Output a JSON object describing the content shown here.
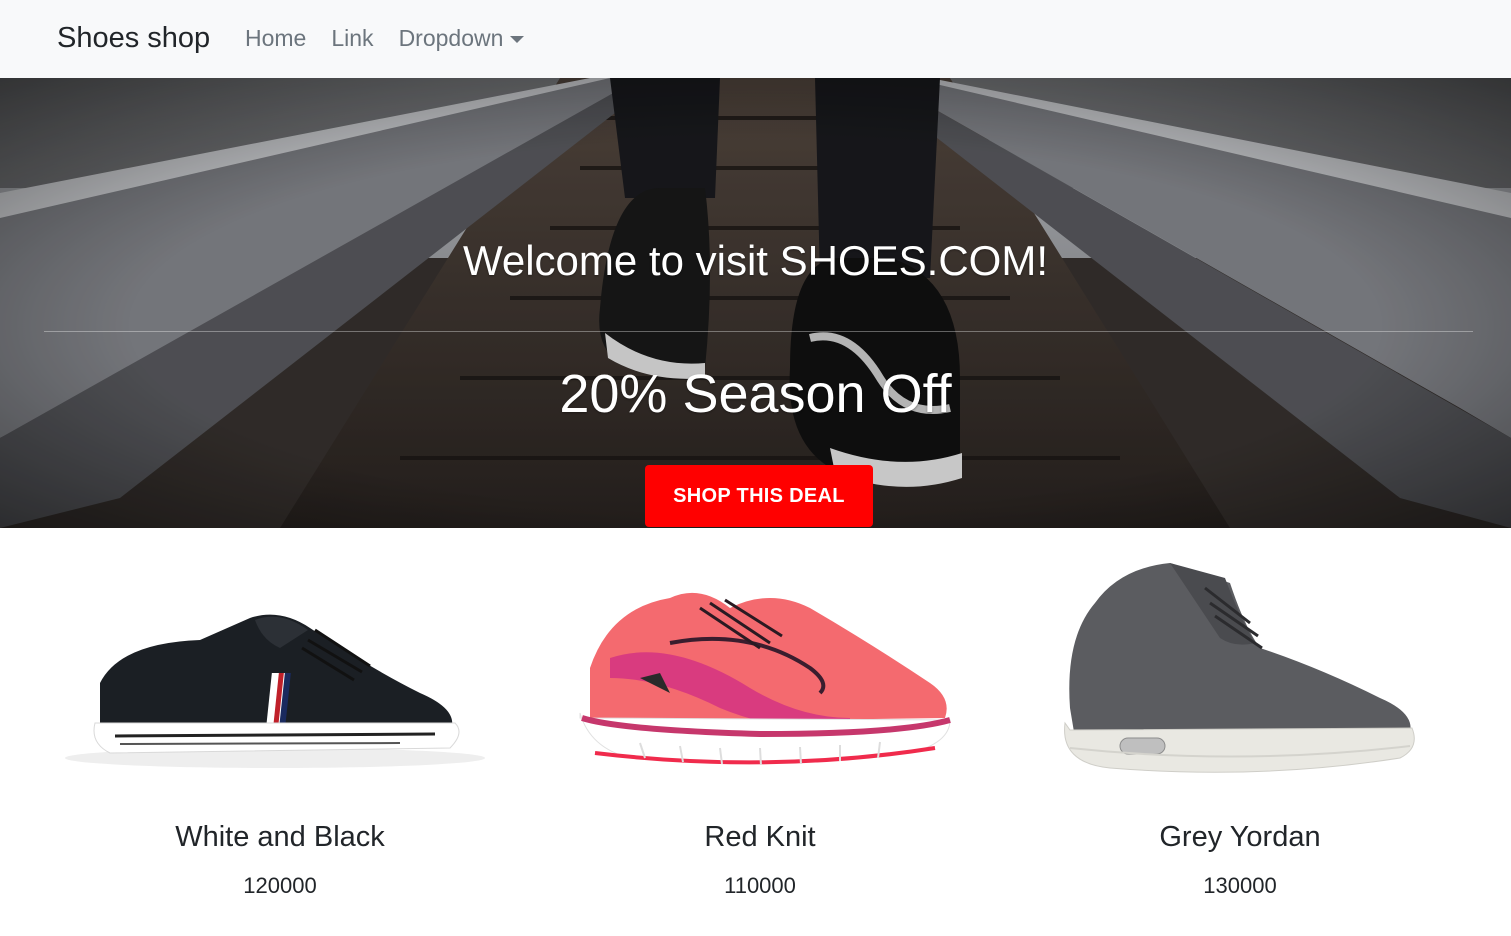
{
  "navbar": {
    "brand": "Shoes shop",
    "links": [
      {
        "label": "Home"
      },
      {
        "label": "Link"
      },
      {
        "label": "Dropdown"
      }
    ]
  },
  "hero": {
    "title": "Welcome to visit SHOES.COM!",
    "subtitle": "20% Season Off",
    "button_label": "SHOP THIS DEAL",
    "button_color": "#ff0000"
  },
  "products": [
    {
      "name": "White and Black",
      "price": "120000"
    },
    {
      "name": "Red Knit",
      "price": "110000"
    },
    {
      "name": "Grey Yordan",
      "price": "130000"
    }
  ]
}
